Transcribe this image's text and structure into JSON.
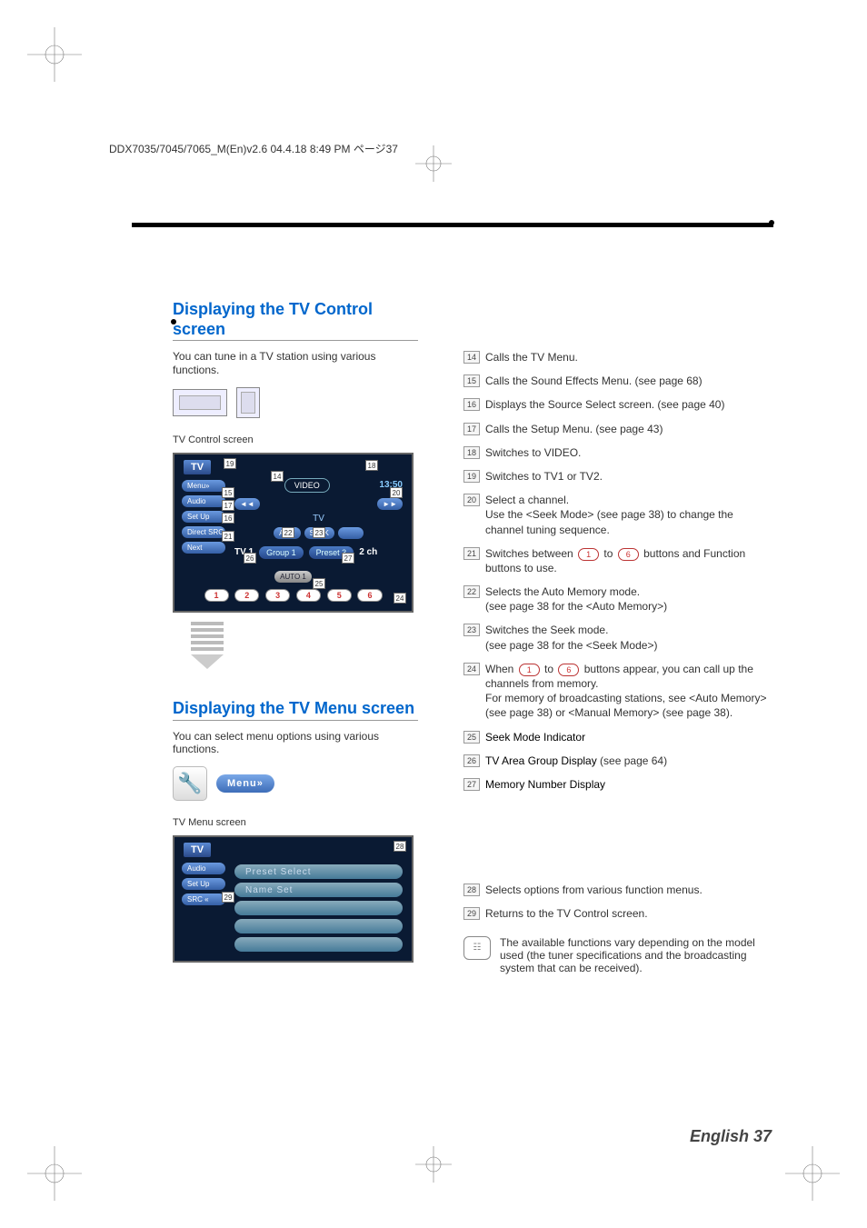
{
  "header_line": "DDX7035/7045/7065_M(En)v2.6  04.4.18  8:49 PM  ページ37",
  "section1": {
    "title": "Displaying the TV Control screen",
    "intro": "You can tune in a TV station using various functions.",
    "caption": "TV Control screen",
    "screen": {
      "src": "TV",
      "menu": "Menu»",
      "video": "VIDEO",
      "time": "13:50",
      "audio": "Audio",
      "setup": "Set Up",
      "direct": "Direct SRC",
      "next": "Next",
      "ame": "AME",
      "seek": "SEEK",
      "tv_label": "TV",
      "status": "TV 1",
      "group": "Group 1",
      "preset": "Preset 3",
      "ch": "2 ch",
      "auto": "AUTO 1",
      "n1": "1",
      "n2": "2",
      "n3": "3",
      "n4": "4",
      "n5": "5",
      "n6": "6"
    }
  },
  "section2": {
    "title": "Displaying the TV Menu screen",
    "intro": "You can select menu options using various functions.",
    "menu_label": "Menu»",
    "caption": "TV Menu screen",
    "screen": {
      "src": "TV",
      "audio": "Audio",
      "setup": "Set Up",
      "back": "SRC «",
      "opt1": "Preset Select",
      "opt2": "Name Set"
    }
  },
  "descriptions": {
    "i14": "Calls the TV Menu.",
    "i15": "Calls the Sound Effects Menu. (see page 68)",
    "i16": "Displays the Source Select screen. (see page 40)",
    "i17": "Calls the Setup Menu. (see page 43)",
    "i18": "Switches to VIDEO.",
    "i19": "Switches to TV1 or TV2.",
    "i20a": "Select a channel.",
    "i20b": "Use the <Seek Mode> (see page 38) to change the channel tuning sequence.",
    "i21a": "Switches between ",
    "i21b": " to ",
    "i21c": " buttons and Function buttons to use.",
    "i22a": "Selects the Auto Memory mode.",
    "i22b": "(see page 38 for the <Auto Memory>)",
    "i23a": "Switches the Seek mode.",
    "i23b": "(see page 38 for the <Seek Mode>)",
    "i24a": "When ",
    "i24b": " to ",
    "i24c": " buttons appear, you can call up the channels from memory.",
    "i24d": "For memory of broadcasting stations, see <Auto Memory> (see page 38) or <Manual Memory> (see page 38).",
    "i25": "Seek Mode Indicator",
    "i26a": "TV Area Group Display",
    "i26b": " (see page 64)",
    "i27": "Memory Number Display",
    "i28": "Selects options from various function menus.",
    "i29": "Returns to the TV Control screen.",
    "pill1": "1",
    "pill6": "6"
  },
  "note": "The available functions vary depending on the model used (the tuner specifications and the broadcasting system that can be received).",
  "footer": "English 37"
}
